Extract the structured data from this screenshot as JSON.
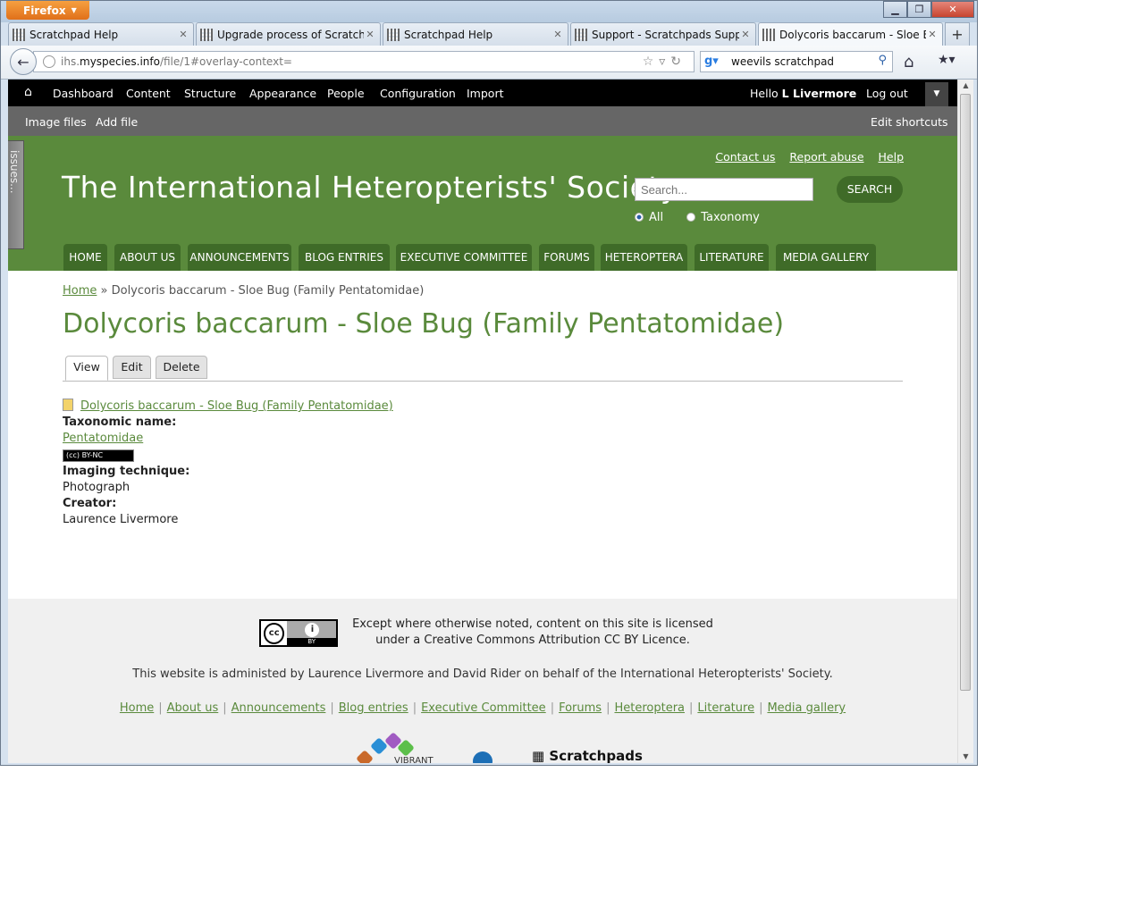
{
  "browser": {
    "menu_label": "Firefox",
    "tabs": [
      {
        "label": "Scratchpad Help"
      },
      {
        "label": "Upgrade process of Scratchpa..."
      },
      {
        "label": "Scratchpad Help"
      },
      {
        "label": "Support - Scratchpads Support"
      },
      {
        "label": "Dolycoris baccarum - Sloe Bu..."
      }
    ],
    "url_prefix": "ihs.",
    "url_host": "myspecies.info",
    "url_path": "/file/1#overlay-context=",
    "search_value": "weevils scratchpad"
  },
  "admin_toolbar": {
    "items": [
      "Dashboard",
      "Content",
      "Structure",
      "Appearance",
      "People",
      "Configuration",
      "Import"
    ],
    "hello": "Hello",
    "user": "L Livermore",
    "logout": "Log out"
  },
  "shortcuts": {
    "items": [
      "Image files",
      "Add file"
    ],
    "edit": "Edit shortcuts"
  },
  "issues_tab": "issues...",
  "header": {
    "top_links": [
      "Contact us",
      "Report abuse",
      "Help"
    ],
    "site_name": "The International Heteropterists' Society",
    "search_placeholder": "Search...",
    "search_button": "SEARCH",
    "radio_all": "All",
    "radio_taxonomy": "Taxonomy"
  },
  "main_nav": [
    "HOME",
    "ABOUT US",
    "ANNOUNCEMENTS",
    "BLOG ENTRIES",
    "EXECUTIVE COMMITTEE",
    "FORUMS",
    "HETEROPTERA",
    "LITERATURE",
    "MEDIA GALLERY"
  ],
  "content": {
    "breadcrumb_home": "Home",
    "breadcrumb_sep": " » ",
    "breadcrumb_current": "Dolycoris baccarum - Sloe Bug (Family Pentatomidae)",
    "title": "Dolycoris baccarum - Sloe Bug (Family Pentatomidae)",
    "tabs": [
      "View",
      "Edit",
      "Delete"
    ],
    "file_link": "Dolycoris baccarum - Sloe Bug (Family Pentatomidae)",
    "taxonomic_label": "Taxonomic name:",
    "taxonomic_value": "Pentatomidae",
    "cc_badge": "BY-NC",
    "imaging_label": "Imaging technique:",
    "imaging_value": "Photograph",
    "creator_label": "Creator:",
    "creator_value": "Laurence Livermore"
  },
  "footer": {
    "license_line1": "Except where otherwise noted, content on this site is licensed",
    "license_line2": "under a Creative Commons Attribution CC BY Licence.",
    "admin_text": "This website is administed by Laurence Livermore and David Rider on behalf of the International Heteropterists' Society.",
    "links": [
      "Home",
      "About us",
      "Announcements",
      "Blog entries",
      "Executive Committee",
      "Forums",
      "Heteroptera",
      "Literature",
      "Media gallery"
    ],
    "vibrant": "VIBRANT",
    "scratchpads": "Scratchpads"
  }
}
